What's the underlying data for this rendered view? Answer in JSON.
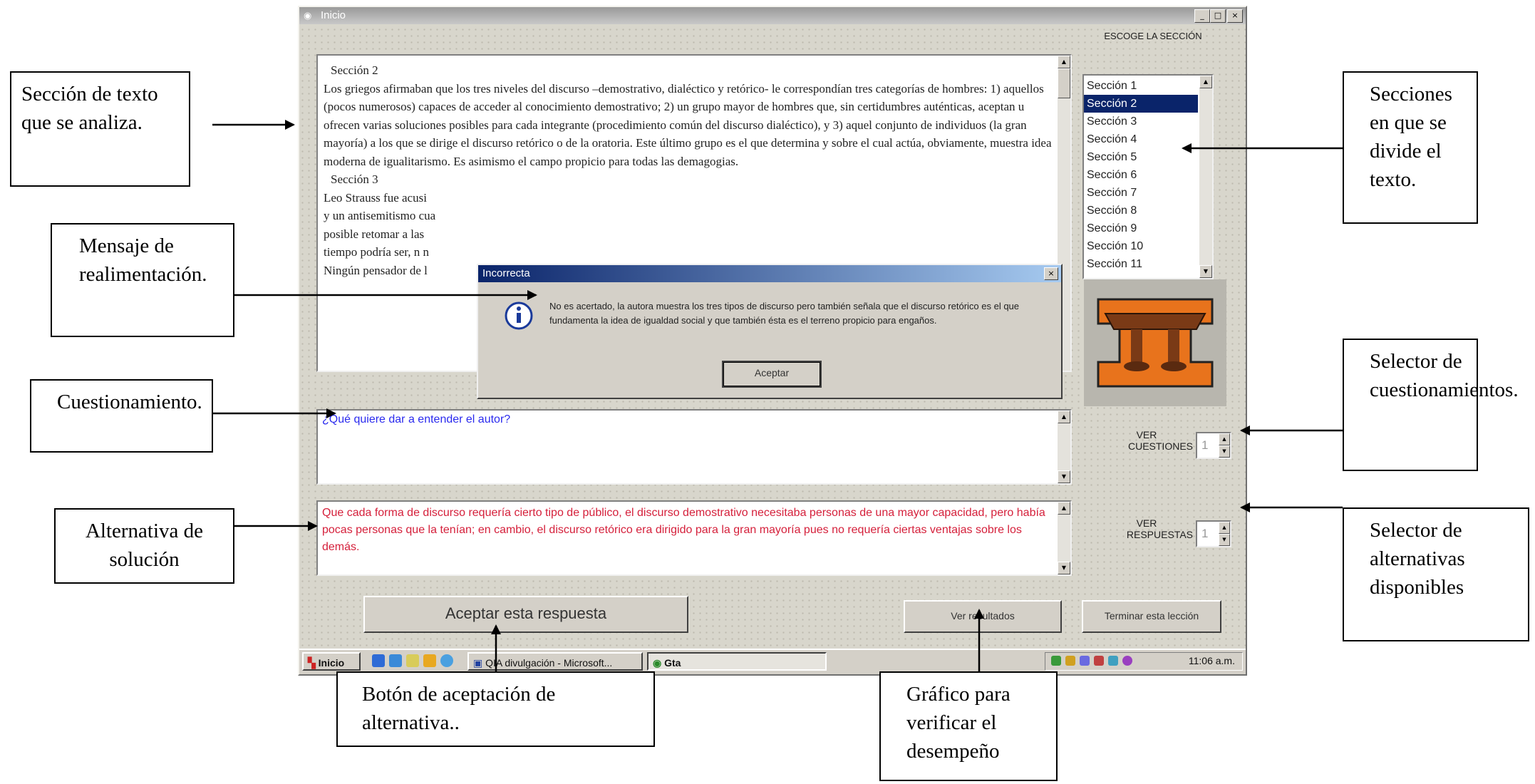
{
  "window": {
    "title": "Inicio",
    "controls": [
      "_",
      "□",
      "×"
    ]
  },
  "reading_panel": {
    "paragraphs": [
      {
        "kind": "heading",
        "text": "Sección 2"
      },
      {
        "kind": "body",
        "text": "Los griegos afirmaban que los tres niveles del discurso –demostrativo, dialéctico y retórico- le correspondían tres categorías de hombres: 1) aquellos (pocos numerosos) capaces de acceder al conocimiento demostrativo; 2) un grupo mayor de hombres que, sin certidumbres auténticas, aceptan u ofrecen varias soluciones posibles para cada integrante (procedimiento común del discurso dialéctico), y 3) aquel conjunto de individuos (la gran mayoría) a los que se dirige el discurso retórico o de la oratoria. Este último grupo es el que determina y sobre el cual actúa, obviamente, muestra idea moderna de igualitarismo. Es asimismo el campo propicio para todas las demagogias."
      },
      {
        "kind": "heading",
        "text": "Sección 3"
      },
      {
        "kind": "body",
        "text": "Leo Strauss fue acusi"
      },
      {
        "kind": "body",
        "text": "y un antisemitismo cua"
      },
      {
        "kind": "body",
        "text": "posible retomar a las"
      },
      {
        "kind": "body",
        "text": "tiempo podría ser, n n"
      },
      {
        "kind": "body",
        "text": "Ningún pensador de l"
      }
    ]
  },
  "section_selector": {
    "label": "ESCOGE LA SECCIÓN",
    "items": [
      "Sección 1",
      "Sección 2",
      "Sección 3",
      "Sección 4",
      "Sección 5",
      "Sección 6",
      "Sección 7",
      "Sección 8",
      "Sección 9",
      "Sección 10",
      "Sección 11"
    ],
    "selected": "Sección 2"
  },
  "dialog": {
    "title": "Incorrecta",
    "message": "No es acertado, la autora muestra los tres tipos de discurso pero también señala que el discurso retórico es el que fundamenta la idea de igualdad social y que también ésta es el terreno propicio para engaños.",
    "ok_label": "Aceptar",
    "icon": "info-icon"
  },
  "question": {
    "text": "¿Qué quiere dar a entender el autor?"
  },
  "answer": {
    "text": "Que cada forma de discurso requería cierto tipo de público, el discurso demostrativo necesitaba personas de una mayor capacidad, pero había pocas personas que la tenían; en cambio, el discurso retórico era dirigido para la gran mayoría pues no requería ciertas ventajas sobre los demás."
  },
  "spinners": {
    "questions": {
      "label_line1": "VER",
      "label_line2": "CUESTIONES",
      "value": "1"
    },
    "answers": {
      "label_line1": "VER",
      "label_line2": "RESPUESTAS",
      "value": "1"
    }
  },
  "buttons": {
    "accept": "Aceptar esta respuesta",
    "results": "Ver resultados",
    "finish": "Terminar esta lección"
  },
  "taskbar": {
    "start": "Inicio",
    "tasks": [
      "QIA divulgación - Microsoft...",
      "Gta"
    ],
    "clock": "11:06 a.m."
  },
  "callouts": {
    "text_section": "Sección de texto que se analiza.",
    "feedback": "Mensaje de realimentación.",
    "questionnaire": "Cuestionamiento.",
    "alternative": "Alternativa de solución",
    "sections": "Secciones en que se divide el texto.",
    "question_selector": "Selector de cuestionamientos.",
    "alternative_selector": "Selector de alternativas disponibles",
    "accept_button": "Botón de aceptación de alternativa..",
    "graph": "Gráfico para verificar el desempeño"
  },
  "colors": {
    "window_bg": "#d8d6cc",
    "selection": "#0a246a",
    "question_text": "#2a2aee",
    "answer_text": "#d5203b",
    "logo_orange": "#e8731c",
    "logo_brown": "#7a3a16"
  }
}
